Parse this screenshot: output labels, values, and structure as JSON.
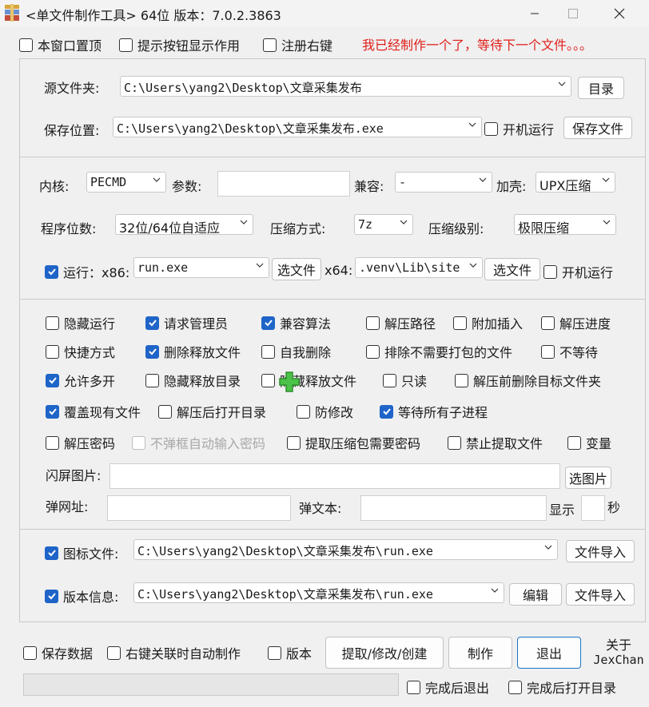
{
  "window": {
    "title": "<单文件制作工具> 64位 版本：7.0.2.3863",
    "minimize_icon": "minimize-icon",
    "maximize_icon": "maximize-icon",
    "close_icon": "close-icon"
  },
  "top_options": {
    "on_top": "本窗口置顶",
    "tooltip": "提示按钮显示作用",
    "register": "注册右键",
    "status": "我已经制作一个了，等待下一个文件。。。"
  },
  "source": {
    "folder_label": "源文件夹:",
    "folder_value": "C:\\Users\\yang2\\Desktop\\文章采集发布",
    "dir_button": "目录",
    "save_label": "保存位置:",
    "save_value": "C:\\Users\\yang2\\Desktop\\文章采集发布.exe",
    "autorun": "开机运行",
    "save_button": "保存文件"
  },
  "config": {
    "kernel_label": "内核:",
    "kernel_value": "PECMD",
    "param_label": "参数:",
    "param_value": "",
    "compat_label": "兼容:",
    "compat_value": "-",
    "shell_label": "加壳:",
    "shell_value": "UPX压缩",
    "bits_label": "程序位数:",
    "bits_value": "32位/64位自适应",
    "method_label": "压缩方式:",
    "method_value": "7z",
    "level_label": "压缩级别:",
    "level_value": "极限压缩",
    "run_label": "运行：x86:",
    "run_x86_value": "run.exe",
    "select_file": "选文件",
    "x64_label": "x64:",
    "run_x64_value": ".venv\\Lib\\site",
    "autorun": "开机运行"
  },
  "options": {
    "row1": [
      "隐藏运行",
      "请求管理员",
      "兼容算法",
      "解压路径",
      "附加插入",
      "解压进度"
    ],
    "row2": [
      "快捷方式",
      "删除释放文件",
      "自我删除",
      "排除不需要打包的文件",
      "不等待"
    ],
    "row3": [
      "允许多开",
      "隐藏释放目录",
      "隐藏释放文件",
      "只读",
      "解压前删除目标文件夹"
    ],
    "row4": [
      "覆盖现有文件",
      "解压后打开目录",
      "防修改",
      "等待所有子进程"
    ],
    "row5": [
      "解压密码",
      "不弹框自动输入密码",
      "提取压缩包需要密码",
      "禁止提取文件",
      "变量"
    ],
    "splash_label": "闪屏图片:",
    "splash_value": "",
    "select_image": "选图片",
    "popup_url_label": "弹网址:",
    "popup_url_value": "",
    "popup_text_label": "弹文本:",
    "popup_text_value": "",
    "show_label": "显示",
    "show_value": "",
    "seconds_label": "秒"
  },
  "icon_version": {
    "icon_label": "图标文件:",
    "icon_value": "C:\\Users\\yang2\\Desktop\\文章采集发布\\run.exe",
    "import_button": "文件导入",
    "version_label": "版本信息:",
    "version_value": "C:\\Users\\yang2\\Desktop\\文章采集发布\\run.exe",
    "edit_button": "编辑"
  },
  "footer": {
    "save_data": "保存数据",
    "right_click_auto": "右键关联时自动制作",
    "version_chk": "版本",
    "extract_button": "提取/修改/创建",
    "make_button": "制作",
    "exit_button": "退出",
    "about_line1": "关于",
    "about_line2": "JexChan",
    "exit_after": "完成后退出",
    "open_after": "完成后打开目录",
    "progress": 0
  }
}
